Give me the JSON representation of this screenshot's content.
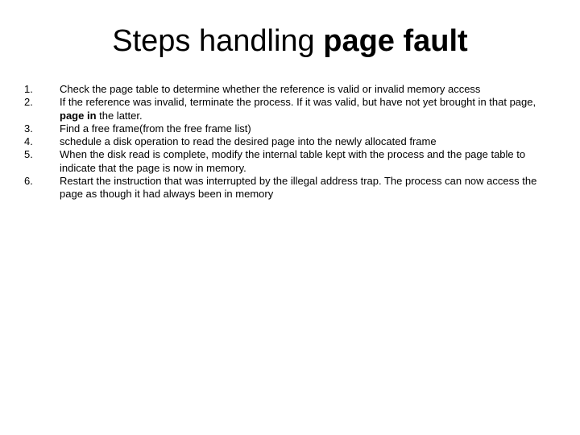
{
  "title": {
    "part1": "Steps handling ",
    "part2_bold": "page fault"
  },
  "items": [
    {
      "num": "1.",
      "text": "Check the page table to determine whether the reference is valid or invalid memory access"
    },
    {
      "num": "2.",
      "text_pre": "If the reference was invalid, terminate the process. If it was valid, but have not yet brought in that page, ",
      "text_bold": "page in",
      "text_post": " the latter."
    },
    {
      "num": "3.",
      "text": "Find a free frame(from the free frame list)"
    },
    {
      "num": "4.",
      "text": "schedule a disk operation to read the desired page into the newly allocated frame"
    },
    {
      "num": "5.",
      "text": "When the disk read is complete, modify the internal table kept with the process and the page table to indicate that the page is now in memory."
    },
    {
      "num": "6.",
      "text": "Restart the instruction that was interrupted by the illegal address trap. The process can now access the page as though it had always been in memory"
    }
  ]
}
